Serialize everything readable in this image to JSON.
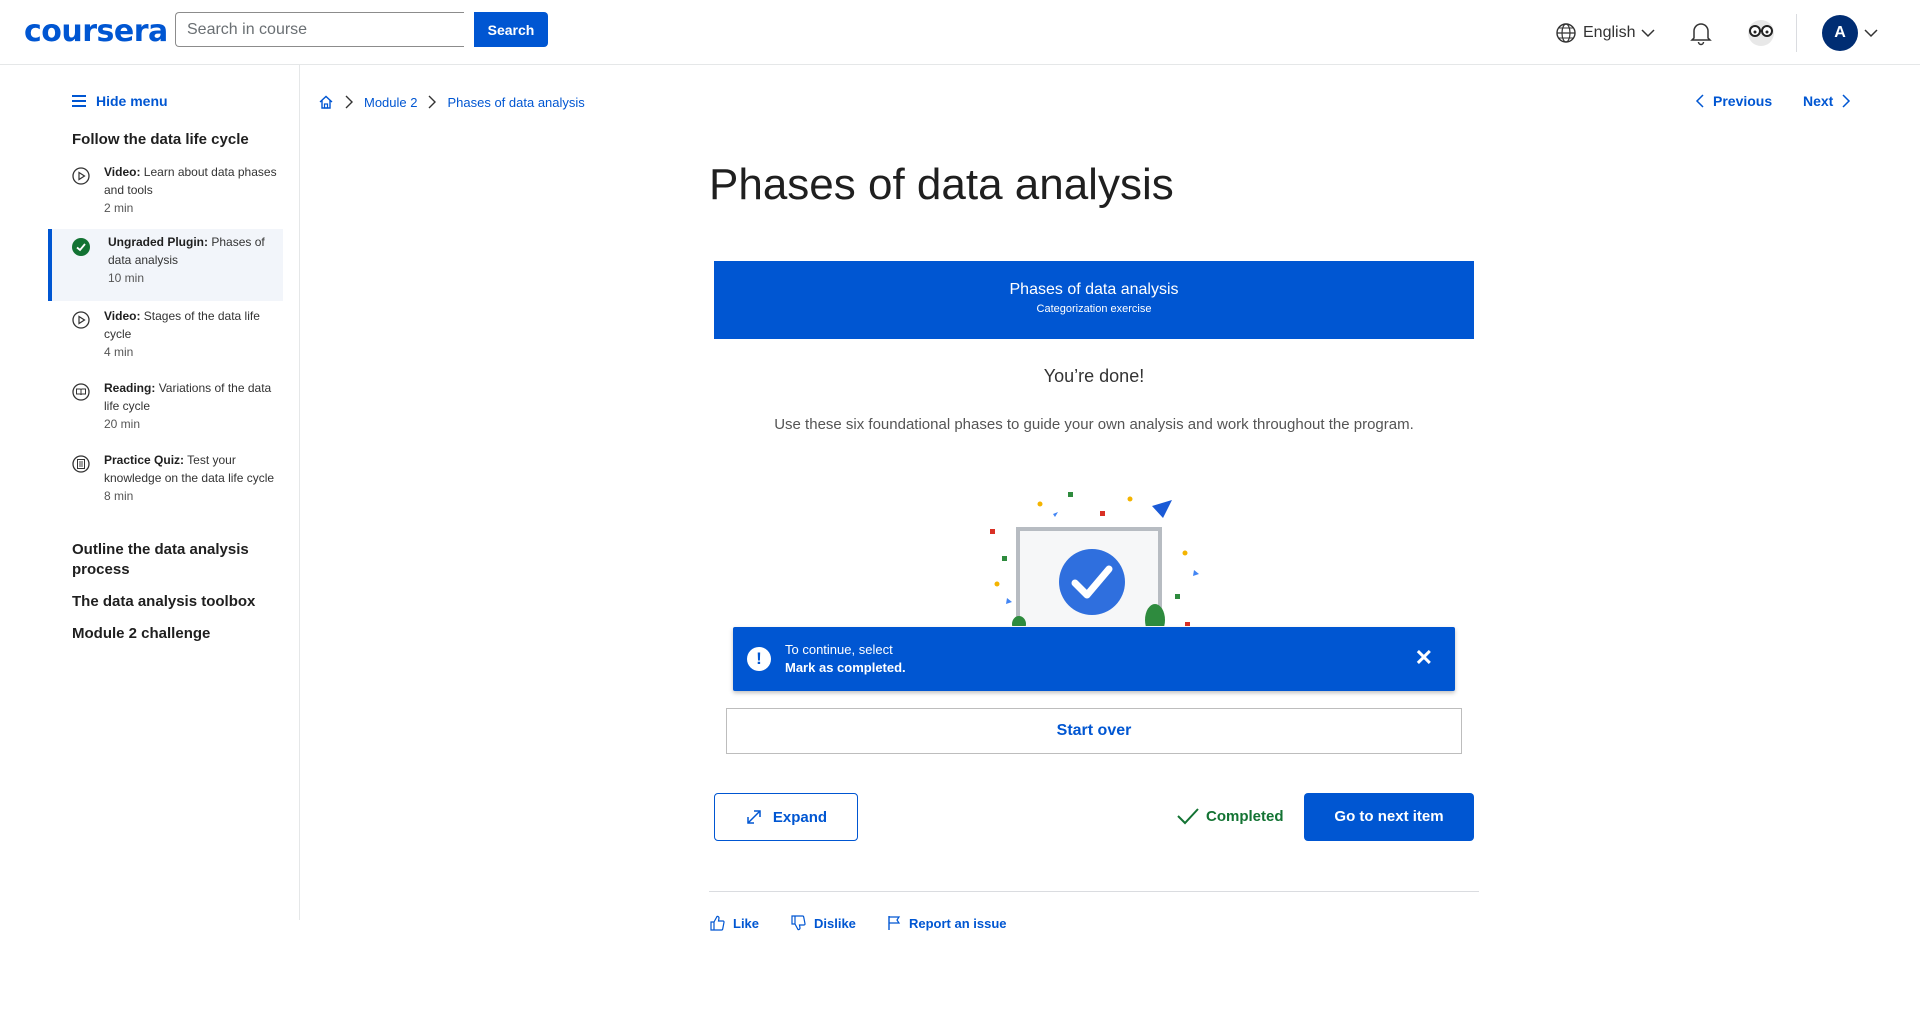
{
  "header": {
    "logo": "coursera",
    "search_placeholder": "Search in course",
    "search_button": "Search",
    "language": "English",
    "avatar_initial": "A"
  },
  "sidebar": {
    "hide_menu": "Hide menu",
    "section1_title": "Follow the data life cycle",
    "items": [
      {
        "type": "Video:",
        "title": "Learn about data phases and tools",
        "duration": "2 min",
        "icon": "play-icon"
      },
      {
        "type": "Ungraded Plugin:",
        "title": "Phases of data analysis",
        "duration": "10 min",
        "icon": "check-circle-icon"
      },
      {
        "type": "Video:",
        "title": "Stages of the data life cycle",
        "duration": "4 min",
        "icon": "play-icon"
      },
      {
        "type": "Reading:",
        "title": "Variations of the data life cycle",
        "duration": "20 min",
        "icon": "book-icon"
      },
      {
        "type": "Practice Quiz:",
        "title": "Test your knowledge on the data life cycle",
        "duration": "8 min",
        "icon": "quiz-icon"
      }
    ],
    "section2_title": "Outline the data analysis process",
    "section3_title": "The data analysis toolbox",
    "section4_title": "Module 2 challenge"
  },
  "breadcrumb": {
    "module": "Module 2",
    "current": "Phases of data analysis"
  },
  "nav": {
    "previous": "Previous",
    "next": "Next"
  },
  "main": {
    "title": "Phases of data analysis",
    "banner_title": "Phases of data analysis",
    "banner_subtitle": "Categorization exercise",
    "done_text": "You’re done!",
    "description": "Use these six foundational phases to guide your own analysis and work throughout the program.",
    "toast_line1": "To continue, select",
    "toast_line2": "Mark as completed.",
    "start_over": "Start over",
    "expand": "Expand",
    "completed": "Completed",
    "next_item": "Go to next item"
  },
  "feedback": {
    "like": "Like",
    "dislike": "Dislike",
    "report": "Report an issue"
  },
  "colors": {
    "brand": "#0056d2",
    "success": "#137333"
  }
}
